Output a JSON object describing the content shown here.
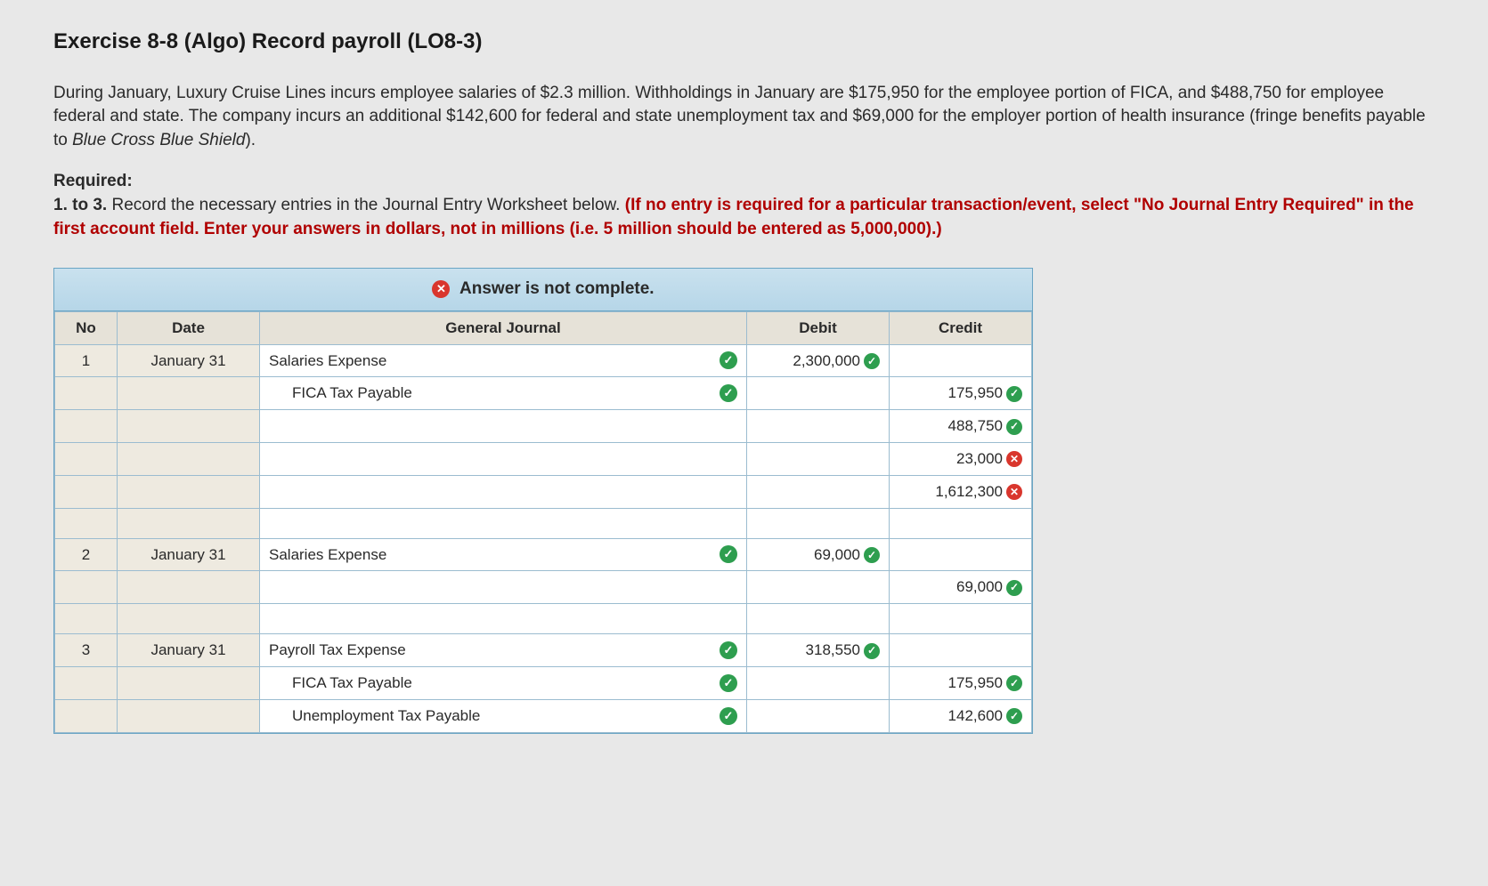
{
  "title": "Exercise 8-8 (Algo) Record payroll (LO8-3)",
  "problem": {
    "p1a": "During January, Luxury Cruise Lines incurs employee salaries of $2.3 million. Withholdings in January are $175,950 for the employee portion of FICA, and $488,750 for employee federal and state. The company incurs an additional $142,600 for federal and state unemployment tax and $69,000 for the employer portion of health insurance (fringe benefits payable to ",
    "p1b": "Blue Cross Blue Shield",
    "p1c": ")."
  },
  "required": {
    "label": "Required:",
    "lead": "1. to 3.",
    "text_a": " Record the necessary entries in the Journal Entry Worksheet below. ",
    "text_b": "(If no entry is required for a particular transaction/event, select \"No Journal Entry Required\" in the first account field. Enter your answers in dollars, not in millions (i.e. 5 million should be entered as 5,000,000).)"
  },
  "status": "Answer is not complete.",
  "headers": {
    "no": "No",
    "date": "Date",
    "journal": "General Journal",
    "debit": "Debit",
    "credit": "Credit"
  },
  "rows": [
    {
      "no": "1",
      "date": "January 31",
      "account": "Salaries Expense",
      "indent": false,
      "row_mark": "check",
      "debit": "2,300,000",
      "debit_mark": "check",
      "credit": "",
      "credit_mark": ""
    },
    {
      "no": "",
      "date": "",
      "account": "FICA Tax Payable",
      "indent": true,
      "row_mark": "check",
      "debit": "",
      "debit_mark": "",
      "credit": "175,950",
      "credit_mark": "check"
    },
    {
      "no": "",
      "date": "",
      "account": "",
      "indent": false,
      "row_mark": "",
      "debit": "",
      "debit_mark": "",
      "credit": "488,750",
      "credit_mark": "check"
    },
    {
      "no": "",
      "date": "",
      "account": "",
      "indent": false,
      "row_mark": "",
      "debit": "",
      "debit_mark": "",
      "credit": "23,000",
      "credit_mark": "xmark"
    },
    {
      "no": "",
      "date": "",
      "account": "",
      "indent": false,
      "row_mark": "",
      "debit": "",
      "debit_mark": "",
      "credit": "1,612,300",
      "credit_mark": "xmark"
    },
    {
      "no": "",
      "date": "",
      "account": "",
      "indent": false,
      "row_mark": "",
      "debit": "",
      "debit_mark": "",
      "credit": "",
      "credit_mark": ""
    },
    {
      "no": "2",
      "date": "January 31",
      "account": "Salaries Expense",
      "indent": false,
      "row_mark": "check",
      "debit": "69,000",
      "debit_mark": "check",
      "credit": "",
      "credit_mark": ""
    },
    {
      "no": "",
      "date": "",
      "account": "",
      "indent": false,
      "row_mark": "",
      "debit": "",
      "debit_mark": "",
      "credit": "69,000",
      "credit_mark": "check"
    },
    {
      "no": "",
      "date": "",
      "account": "",
      "indent": false,
      "row_mark": "",
      "debit": "",
      "debit_mark": "",
      "credit": "",
      "credit_mark": ""
    },
    {
      "no": "3",
      "date": "January 31",
      "account": "Payroll Tax Expense",
      "indent": false,
      "row_mark": "check",
      "debit": "318,550",
      "debit_mark": "check",
      "credit": "",
      "credit_mark": ""
    },
    {
      "no": "",
      "date": "",
      "account": "FICA Tax Payable",
      "indent": true,
      "row_mark": "check",
      "debit": "",
      "debit_mark": "",
      "credit": "175,950",
      "credit_mark": "check"
    },
    {
      "no": "",
      "date": "",
      "account": "Unemployment Tax Payable",
      "indent": true,
      "row_mark": "check",
      "debit": "",
      "debit_mark": "",
      "credit": "142,600",
      "credit_mark": "check"
    }
  ]
}
